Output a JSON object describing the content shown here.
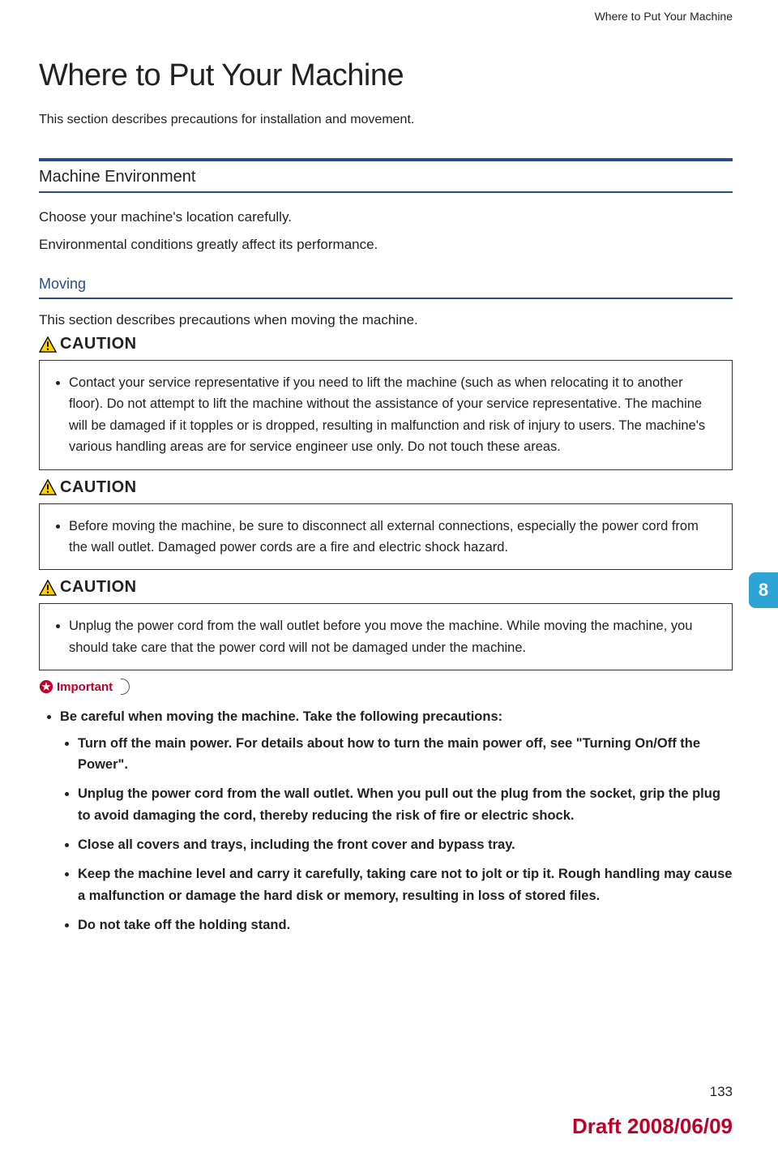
{
  "header": {
    "running_title": "Where to Put Your Machine"
  },
  "title": "Where to Put Your Machine",
  "intro": "This section describes precautions for installation and movement.",
  "section1": {
    "heading": "Machine Environment",
    "p1": "Choose your machine's location carefully.",
    "p2": "Environmental conditions greatly affect its performance."
  },
  "section2": {
    "heading": "Moving",
    "intro": "This section describes precautions when moving the machine."
  },
  "caution_label": "CAUTION",
  "cautions": [
    "Contact your service representative if you need to lift the machine (such as when relocating it to another floor). Do not attempt to lift the machine without the assistance of your service representative. The machine will be damaged if it topples or is dropped, resulting in malfunction and risk of injury to users. The machine's various handling areas are for service engineer use only. Do not touch these areas.",
    "Before moving the machine, be sure to disconnect all external connections, especially the power cord from the wall outlet. Damaged power cords are a fire and electric shock hazard.",
    "Unplug the power cord from the wall outlet before you move the machine. While moving the machine, you should take care that the power cord will not be damaged under the machine."
  ],
  "important_label": "Important",
  "important": {
    "lead": "Be careful when moving the machine. Take the following precautions:",
    "items": [
      "Turn off the main power. For details about how to turn the main power off, see \"Turning On/Off the Power\".",
      "Unplug the power cord from the wall outlet. When you pull out the plug from the socket, grip the plug to avoid damaging the cord, thereby reducing the risk of fire or electric shock.",
      "Close all covers and trays, including the front cover and bypass tray.",
      "Keep the machine level and carry it carefully, taking care not to jolt or tip it. Rough handling may cause a malfunction or damage the hard disk or memory, resulting in loss of stored files.",
      "Do not take off the holding stand."
    ]
  },
  "chapter_tab": "8",
  "page_number": "133",
  "draft": "Draft 2008/06/09"
}
